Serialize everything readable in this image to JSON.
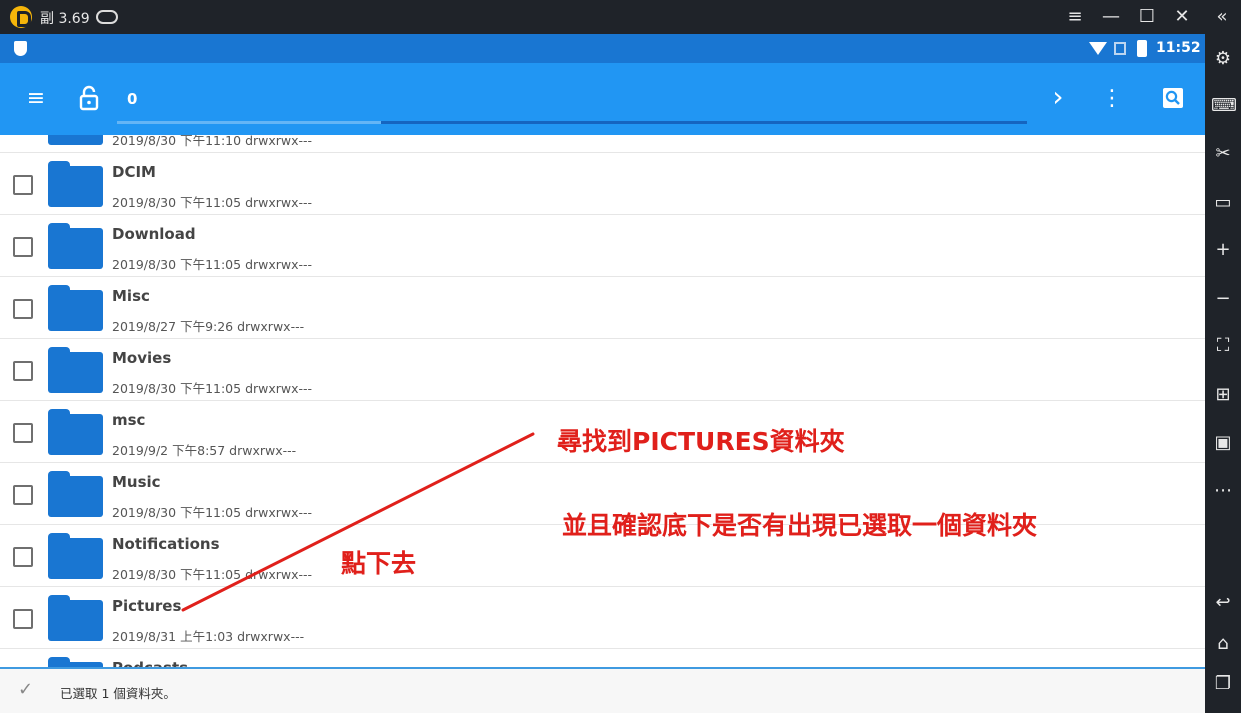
{
  "window": {
    "title": "副 3.69",
    "minimize_glyph": "—",
    "menu_glyph": "≡",
    "maximize_glyph": "☐",
    "close_glyph": "✕",
    "collapse_glyph": "«"
  },
  "status_bar": {
    "time": "11:52"
  },
  "app_bar": {
    "path_label": "0",
    "progress_fraction": 0.29,
    "menu_glyph": "≡",
    "forward_glyph": "›",
    "more_glyph": "⋮"
  },
  "folders": [
    {
      "name": "",
      "meta": "2019/8/30 下午11:10   drwxrwx---"
    },
    {
      "name": "DCIM",
      "meta": "2019/8/30 下午11:05   drwxrwx---"
    },
    {
      "name": "Download",
      "meta": "2019/8/30 下午11:05   drwxrwx---"
    },
    {
      "name": "Misc",
      "meta": "2019/8/27 下午9:26   drwxrwx---"
    },
    {
      "name": "Movies",
      "meta": "2019/8/30 下午11:05   drwxrwx---"
    },
    {
      "name": "msc",
      "meta": "2019/9/2 下午8:57   drwxrwx---"
    },
    {
      "name": "Music",
      "meta": "2019/8/30 下午11:05   drwxrwx---"
    },
    {
      "name": "Notifications",
      "meta": "2019/8/30 下午11:05   drwxrwx---"
    },
    {
      "name": "Pictures",
      "meta": "2019/8/31 上午1:03   drwxrwx---"
    },
    {
      "name": "Podcasts",
      "meta": ""
    }
  ],
  "bottom_bar": {
    "selection_text": "已選取 1 個資料夾。",
    "check_glyph": "✓"
  },
  "annotations": {
    "find": "尋找到PICTURES資料夾",
    "confirm": "並且確認底下是否有出現已選取一個資料夾",
    "tap": "點下去",
    "color": "#e0201b"
  },
  "sidebar": {
    "settings_glyph": "⚙",
    "keyboard_glyph": "⌨",
    "scissors_glyph": "✂",
    "record_glyph": "▭",
    "vol_up_glyph": "+",
    "vol_down_glyph": "−",
    "fullscreen_glyph": "⛶",
    "add_window_glyph": "⊞",
    "apk_glyph": "▣",
    "more_glyph": "⋯",
    "back_glyph": "↩",
    "home_glyph": "⌂",
    "recents_glyph": "❐"
  }
}
